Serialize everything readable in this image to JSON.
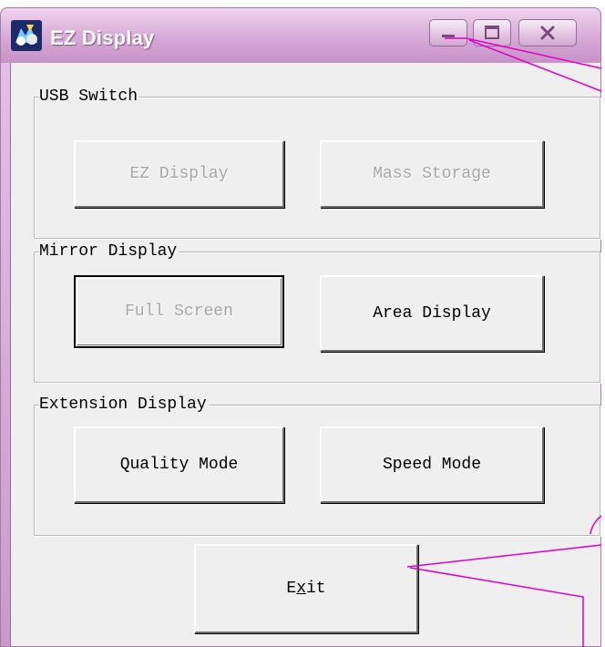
{
  "window": {
    "title": "EZ Display",
    "icon": "ez-display-app-icon",
    "controls": {
      "minimize_icon": "minimize-icon",
      "maximize_icon": "maximize-icon",
      "close_icon": "close-icon"
    },
    "colors": {
      "titlebar": "#d6a9d6",
      "frame": "#c99ac9",
      "client": "#efefef",
      "callout_line": "#e000c8"
    }
  },
  "groups": {
    "usb_switch": {
      "label": "USB Switch",
      "buttons": {
        "ez_display": "EZ Display",
        "mass_storage": "Mass Storage"
      }
    },
    "mirror_display": {
      "label": "Mirror Display",
      "buttons": {
        "full_screen": "Full Screen",
        "area_display": "Area Display"
      }
    },
    "extension_display": {
      "label": "Extension Display",
      "buttons": {
        "quality_mode": "Quality Mode",
        "speed_mode": "Speed Mode"
      }
    }
  },
  "exit": {
    "pre": "E",
    "mnemonic": "x",
    "post": "it"
  }
}
